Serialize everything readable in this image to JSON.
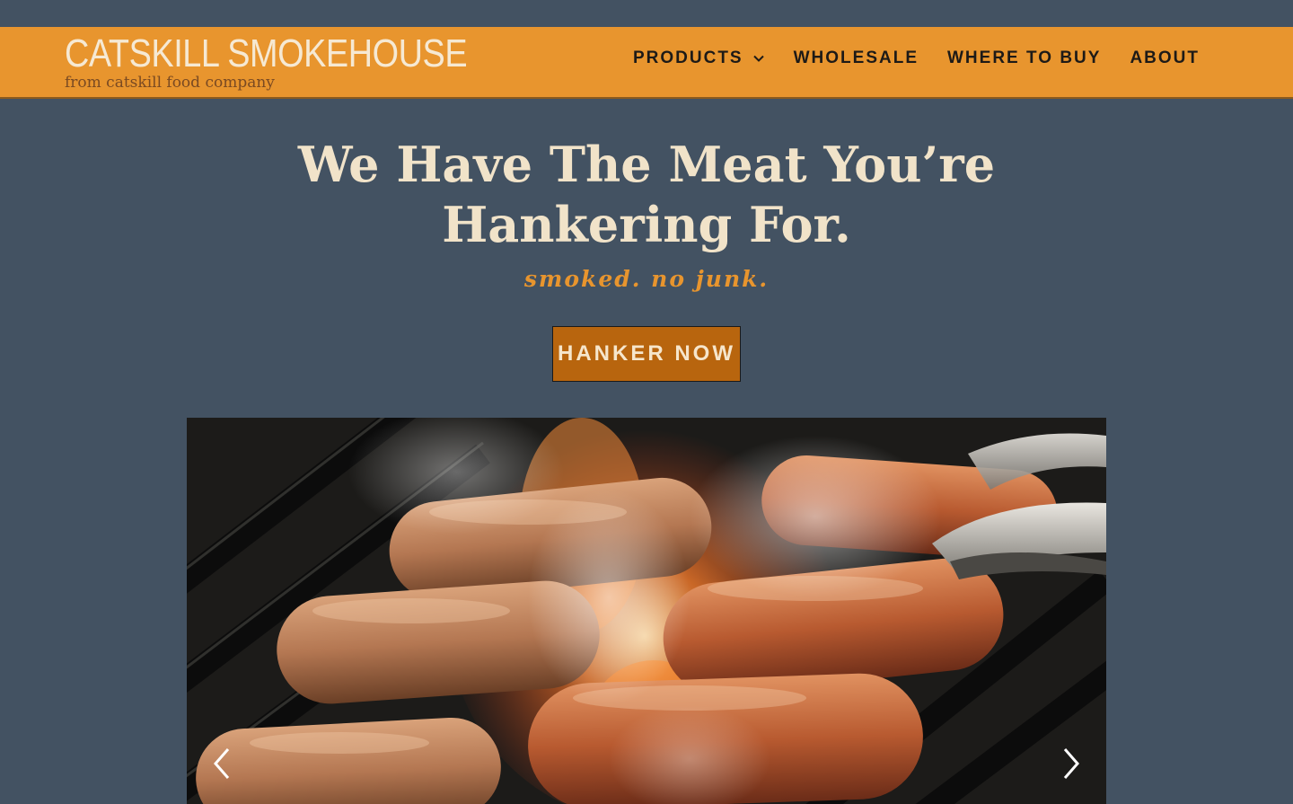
{
  "brand": {
    "title": "CATSKILL SMOKEHOUSE",
    "subtitle": "from catskill food company"
  },
  "nav": {
    "items": [
      {
        "label": "PRODUCTS",
        "icon": "chevron-down-icon"
      },
      {
        "label": "WHOLESALE"
      },
      {
        "label": "WHERE TO BUY"
      },
      {
        "label": "ABOUT"
      }
    ]
  },
  "hero": {
    "title_line1": "We Have The Meat You’re",
    "title_line2": "Hankering For.",
    "subtitle": "smoked. no junk.",
    "cta_label": "HANKER NOW"
  },
  "slider": {
    "image_alt": "sausages-on-grill-photo",
    "prev_icon": "chevron-left-icon",
    "next_icon": "chevron-right-icon"
  },
  "colors": {
    "header_bg": "#e8952e",
    "page_bg": "#435262",
    "cta_bg": "#b8650e",
    "cream": "#f1e3c9"
  }
}
